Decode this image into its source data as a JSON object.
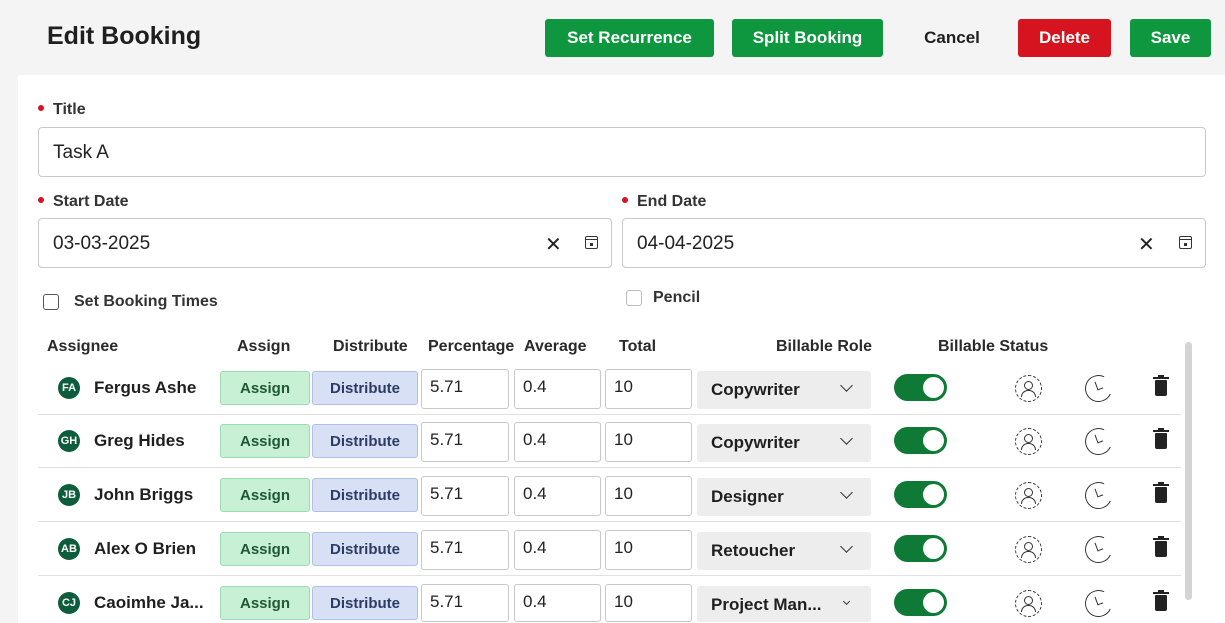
{
  "header": {
    "title": "Edit Booking",
    "buttons": {
      "set_recurrence": "Set Recurrence",
      "split_booking": "Split Booking",
      "cancel": "Cancel",
      "delete": "Delete",
      "save": "Save"
    }
  },
  "form": {
    "title": {
      "label": "Title",
      "value": "Task A"
    },
    "start_date": {
      "label": "Start Date",
      "value": "03-03-2025",
      "clear": "✕"
    },
    "end_date": {
      "label": "End Date",
      "value": "04-04-2025",
      "clear": "✕"
    },
    "set_booking_times": {
      "label": "Set Booking Times",
      "checked": false
    },
    "pencil": {
      "label": "Pencil",
      "checked": false
    }
  },
  "table": {
    "headers": {
      "assignee": "Assignee",
      "assign": "Assign",
      "distribute": "Distribute",
      "percentage": "Percentage",
      "average": "Average",
      "total": "Total",
      "billable_role": "Billable Role",
      "billable_status": "Billable Status"
    },
    "rows": [
      {
        "initials": "FA",
        "name": "Fergus Ashe",
        "assign": "Assign",
        "distribute": "Distribute",
        "percentage": "5.71",
        "average": "0.4",
        "total": "10",
        "role": "Copywriter",
        "billable": true
      },
      {
        "initials": "GH",
        "name": "Greg Hides",
        "assign": "Assign",
        "distribute": "Distribute",
        "percentage": "5.71",
        "average": "0.4",
        "total": "10",
        "role": "Copywriter",
        "billable": true
      },
      {
        "initials": "JB",
        "name": "John Briggs",
        "assign": "Assign",
        "distribute": "Distribute",
        "percentage": "5.71",
        "average": "0.4",
        "total": "10",
        "role": "Designer",
        "billable": true
      },
      {
        "initials": "AB",
        "name": "Alex O Brien",
        "assign": "Assign",
        "distribute": "Distribute",
        "percentage": "5.71",
        "average": "0.4",
        "total": "10",
        "role": "Retoucher",
        "billable": true
      },
      {
        "initials": "CJ",
        "name": "Caoimhe Ja...",
        "assign": "Assign",
        "distribute": "Distribute",
        "percentage": "5.71",
        "average": "0.4",
        "total": "10",
        "role": "Project Man...",
        "billable": true
      }
    ]
  },
  "icons": [
    "calendar-icon",
    "clear-icon",
    "person-dashed-icon",
    "clock-icon",
    "trash-icon",
    "chevron-down-icon"
  ],
  "colors": {
    "primary_green": "#0f9740",
    "danger_red": "#d6141f",
    "toggle_on": "#0f7a36",
    "avatar": "#0d5c3b"
  }
}
